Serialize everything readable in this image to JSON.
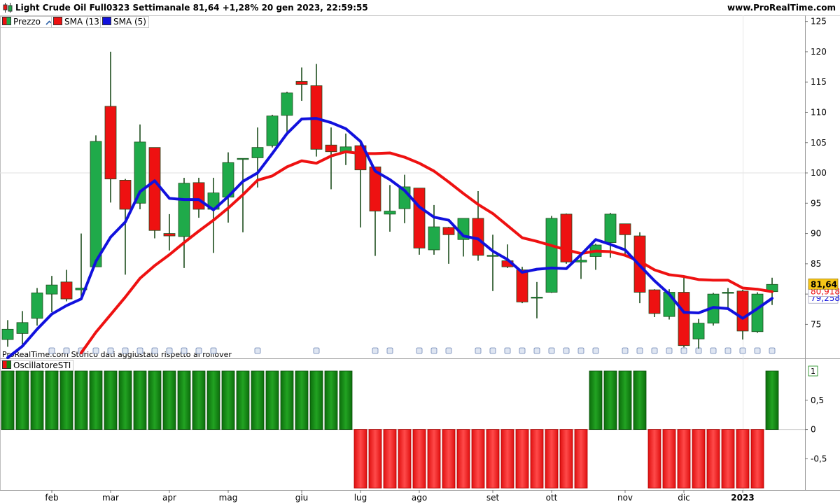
{
  "header": {
    "title": "Light Crude Oil Full0323 Settimanale 81,64 +1,28% 20 gen 2023, 22:59:55",
    "site": "www.ProRealTime.com"
  },
  "legend": {
    "price_label": "Prezzo",
    "sma13_label": "SMA (13)",
    "sma5_label": "SMA (5)",
    "oscillator_label": "OscillatoreSTI"
  },
  "watermark": "ProRealTime.com  Storico dati aggiustato rispetto ai rollover",
  "badges": {
    "last_price": "81,64",
    "sma13_value": "80,918",
    "sma5_value": "79,258",
    "osc_value": "1"
  },
  "colors": {
    "up": "#1faa4a",
    "down": "#ee1111",
    "sma13": "#ee1111",
    "sma5": "#1111dd",
    "price_badge": "#f5c518",
    "osc_positive": "#118811",
    "osc_negative": "#ee1111"
  },
  "chart_data": [
    {
      "type": "candlestick",
      "title": "Light Crude Oil Full0323 Settimanale",
      "y_ticks": [
        75,
        80,
        85,
        90,
        95,
        100,
        105,
        110,
        115,
        120,
        125
      ],
      "y_tick_labels": [
        "75",
        "",
        "85",
        "90",
        "95",
        "100",
        "105",
        "110",
        "115",
        "120",
        "125"
      ],
      "ylim": [
        69.5,
        126
      ],
      "months": [
        {
          "label": "feb",
          "index": 3
        },
        {
          "label": "mar",
          "index": 7
        },
        {
          "label": "apr",
          "index": 11
        },
        {
          "label": "mag",
          "index": 15
        },
        {
          "label": "giu",
          "index": 20
        },
        {
          "label": "lug",
          "index": 24
        },
        {
          "label": "ago",
          "index": 28
        },
        {
          "label": "set",
          "index": 33
        },
        {
          "label": "ott",
          "index": 37
        },
        {
          "label": "nov",
          "index": 42
        },
        {
          "label": "dic",
          "index": 46
        },
        {
          "label": "2023",
          "index": 50
        }
      ],
      "candles": [
        {
          "o": 72.5,
          "h": 75.7,
          "l": 71.3,
          "c": 74.2
        },
        {
          "o": 73.5,
          "h": 77.2,
          "l": 71.7,
          "c": 75.3
        },
        {
          "o": 76,
          "h": 81,
          "l": 74.8,
          "c": 80.2
        },
        {
          "o": 80,
          "h": 83,
          "l": 77,
          "c": 81.5
        },
        {
          "o": 82,
          "h": 84,
          "l": 78.8,
          "c": 79.2
        },
        {
          "o": 80.7,
          "h": 90,
          "l": 79,
          "c": 81
        },
        {
          "o": 84.5,
          "h": 106.2,
          "l": 84.5,
          "c": 105.2
        },
        {
          "o": 111,
          "h": 120,
          "l": 95.1,
          "c": 99
        },
        {
          "o": 98.8,
          "h": 99,
          "l": 83.2,
          "c": 94
        },
        {
          "o": 95,
          "h": 108,
          "l": 94,
          "c": 105.1
        },
        {
          "o": 104.2,
          "h": 104.2,
          "l": 89.2,
          "c": 90.5
        },
        {
          "o": 90,
          "h": 93.2,
          "l": 87.2,
          "c": 89.6
        },
        {
          "o": 89.5,
          "h": 99.2,
          "l": 84.3,
          "c": 98.3
        },
        {
          "o": 98.4,
          "h": 99.2,
          "l": 92.6,
          "c": 94
        },
        {
          "o": 94,
          "h": 99.2,
          "l": 86.8,
          "c": 96.7
        },
        {
          "o": 96,
          "h": 103.4,
          "l": 91.8,
          "c": 101.7
        },
        {
          "o": 102.4,
          "h": 102.4,
          "l": 90.2,
          "c": 102.4
        },
        {
          "o": 102.5,
          "h": 107.5,
          "l": 97.6,
          "c": 104.2
        },
        {
          "o": 104.5,
          "h": 109.6,
          "l": 104.2,
          "c": 109.4
        },
        {
          "o": 109.5,
          "h": 113.4,
          "l": 106.8,
          "c": 113.2
        },
        {
          "o": 115.1,
          "h": 117.4,
          "l": 111.9,
          "c": 114.6
        },
        {
          "o": 114.4,
          "h": 118,
          "l": 102.7,
          "c": 103.9
        },
        {
          "o": 104.6,
          "h": 107.5,
          "l": 97.3,
          "c": 103.5
        },
        {
          "o": 103.4,
          "h": 106.5,
          "l": 101.3,
          "c": 104.3
        },
        {
          "o": 104.5,
          "h": 105,
          "l": 91,
          "c": 100.5
        },
        {
          "o": 101,
          "h": 101,
          "l": 86.3,
          "c": 93.7
        },
        {
          "o": 93.2,
          "h": 98,
          "l": 90.3,
          "c": 93.7
        },
        {
          "o": 94.1,
          "h": 99.7,
          "l": 91.7,
          "c": 97.7
        },
        {
          "o": 97.5,
          "h": 97.5,
          "l": 86.5,
          "c": 87.6
        },
        {
          "o": 87.3,
          "h": 94.7,
          "l": 86.5,
          "c": 91.1
        },
        {
          "o": 91,
          "h": 91.1,
          "l": 85,
          "c": 89.8
        },
        {
          "o": 89,
          "h": 92.5,
          "l": 86.2,
          "c": 92.5
        },
        {
          "o": 92.5,
          "h": 97,
          "l": 85.5,
          "c": 86.4
        },
        {
          "o": 86.4,
          "h": 89.8,
          "l": 80.5,
          "c": 86.4
        },
        {
          "o": 85.5,
          "h": 88.2,
          "l": 84.3,
          "c": 84.5
        },
        {
          "o": 84,
          "h": 84.5,
          "l": 78.5,
          "c": 78.7
        },
        {
          "o": 79.5,
          "h": 82,
          "l": 76,
          "c": 79.5
        },
        {
          "o": 80.3,
          "h": 92.9,
          "l": 80.2,
          "c": 92.5
        },
        {
          "o": 93.2,
          "h": 93.3,
          "l": 85,
          "c": 85.3
        },
        {
          "o": 85.3,
          "h": 86.4,
          "l": 82.5,
          "c": 85.6
        },
        {
          "o": 86.2,
          "h": 88.3,
          "l": 84,
          "c": 88.1
        },
        {
          "o": 88.5,
          "h": 93.4,
          "l": 86,
          "c": 93.2
        },
        {
          "o": 91.6,
          "h": 91.6,
          "l": 86.3,
          "c": 89.8
        },
        {
          "o": 89.6,
          "h": 90.2,
          "l": 78.5,
          "c": 80.3
        },
        {
          "o": 80.7,
          "h": 80.8,
          "l": 76.2,
          "c": 76.8
        },
        {
          "o": 76.3,
          "h": 80.8,
          "l": 75.8,
          "c": 80.3
        },
        {
          "o": 80.3,
          "h": 83,
          "l": 71.2,
          "c": 71.5
        },
        {
          "o": 72.6,
          "h": 75.9,
          "l": 71,
          "c": 75.2
        },
        {
          "o": 75.2,
          "h": 80.2,
          "l": 74.8,
          "c": 80
        },
        {
          "o": 80.2,
          "h": 81,
          "l": 77.7,
          "c": 80.3
        },
        {
          "o": 80.5,
          "h": 80.7,
          "l": 72.5,
          "c": 73.9
        },
        {
          "o": 73.8,
          "h": 80.3,
          "l": 73.6,
          "c": 80
        },
        {
          "o": 80.4,
          "h": 82.7,
          "l": 78.2,
          "c": 81.6
        }
      ],
      "series": [
        {
          "name": "SMA (13)",
          "values": [
            null,
            null,
            null,
            null,
            null,
            70.3,
            73.7,
            76.6,
            79.5,
            82.6,
            84.7,
            86.5,
            88.5,
            90.4,
            92.2,
            94.2,
            96.4,
            98.8,
            99.5,
            101,
            102,
            101.6,
            102.8,
            103.5,
            103.2,
            103.2,
            103.3,
            102.6,
            101.6,
            100.3,
            98.5,
            96.6,
            94.8,
            93.3,
            91.3,
            89.3,
            88.7,
            88,
            87.3,
            86.7,
            87.1,
            87,
            86.4,
            85.4,
            84,
            83.2,
            82.9,
            82.4,
            82.3,
            82.3,
            81,
            80.8,
            80.4
          ]
        },
        {
          "name": "SMA (5)",
          "values": [
            69.5,
            71.4,
            74.2,
            76.7,
            78.1,
            79.2,
            85.4,
            89.4,
            91.9,
            96.9,
            98.7,
            95.8,
            95.6,
            95.6,
            93.9,
            96.1,
            98.6,
            100,
            103.2,
            106.5,
            108.9,
            109,
            108.3,
            107.3,
            105.2,
            100.3,
            98.9,
            97.1,
            94.4,
            92.7,
            92.2,
            89.6,
            89.1,
            87.1,
            85.7,
            83.6,
            84.1,
            84.3,
            84.2,
            86.5,
            89,
            88.2,
            87.3,
            84.7,
            82.2,
            80,
            77,
            76.9,
            77.8,
            77.6,
            76,
            77.6,
            79.3
          ]
        }
      ]
    },
    {
      "type": "bar",
      "title": "OscillatoreSTI",
      "y_ticks": [
        0.5,
        0,
        -0.5
      ],
      "y_tick_labels": [
        "0,5",
        "0",
        "-0,5"
      ],
      "ylim": [
        -0.95,
        1
      ],
      "values": [
        1,
        1,
        1,
        1,
        1,
        1,
        1,
        1,
        1,
        1,
        1,
        1,
        1,
        1,
        1,
        1,
        1,
        1,
        1,
        1,
        1,
        1,
        1,
        1,
        -1,
        -1,
        -1,
        -1,
        -1,
        -1,
        -1,
        -1,
        -1,
        -1,
        -1,
        -1,
        -1,
        -1,
        -1,
        -1,
        1,
        1,
        1,
        1,
        -1,
        -1,
        -1,
        -1,
        -1,
        -1,
        -1,
        -1,
        1
      ]
    }
  ]
}
